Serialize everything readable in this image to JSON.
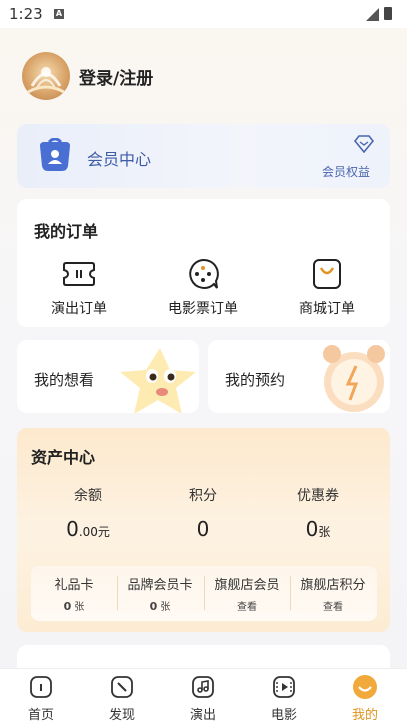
{
  "status": {
    "time": "1:23",
    "indicator": "A"
  },
  "profile": {
    "login_label": "登录/注册"
  },
  "member": {
    "title": "会员中心",
    "rights_label": "会员权益",
    "color": "#3d5ba8"
  },
  "orders": {
    "title": "我的订单",
    "items": [
      {
        "label": "演出订单",
        "icon": "ticket-icon"
      },
      {
        "label": "电影票订单",
        "icon": "popcorn-chat-icon"
      },
      {
        "label": "商城订单",
        "icon": "shopping-bag-icon"
      }
    ]
  },
  "wishlist": {
    "label": "我的想看"
  },
  "reservation": {
    "label": "我的预约"
  },
  "assets": {
    "title": "资产中心",
    "stats": [
      {
        "label": "余额",
        "value": "0",
        "suffix": ".00元"
      },
      {
        "label": "积分",
        "value": "0",
        "suffix": ""
      },
      {
        "label": "优惠券",
        "value": "0",
        "suffix": "张"
      }
    ],
    "perks": [
      {
        "label": "礼品卡",
        "count": "0",
        "unit": "张"
      },
      {
        "label": "品牌会员卡",
        "count": "0",
        "unit": "张"
      },
      {
        "label": "旗舰店会员",
        "detail": "查看"
      },
      {
        "label": "旗舰店积分",
        "detail": "查看"
      }
    ]
  },
  "tabs": [
    {
      "label": "首页",
      "icon": "home-icon"
    },
    {
      "label": "发现",
      "icon": "compass-icon"
    },
    {
      "label": "演出",
      "icon": "music-note-icon"
    },
    {
      "label": "电影",
      "icon": "film-icon"
    },
    {
      "label": "我的",
      "icon": "profile-icon",
      "active": true
    }
  ],
  "accent": "#e0941e"
}
